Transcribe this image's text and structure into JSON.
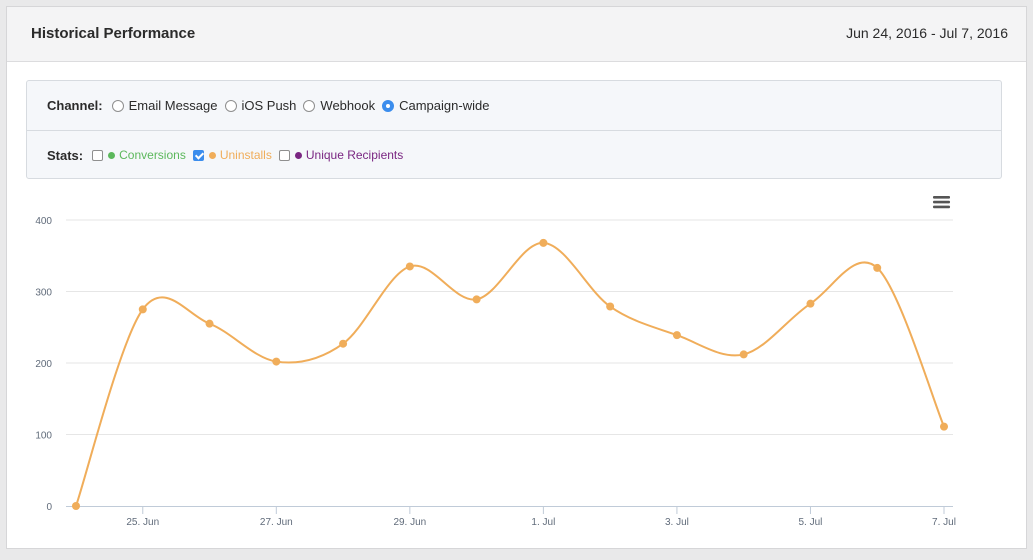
{
  "header": {
    "title": "Historical Performance",
    "date_range": "Jun 24, 2016 - Jul 7, 2016"
  },
  "channel": {
    "label": "Channel:",
    "options": [
      {
        "label": "Email Message",
        "selected": false
      },
      {
        "label": "iOS Push",
        "selected": false
      },
      {
        "label": "Webhook",
        "selected": false
      },
      {
        "label": "Campaign-wide",
        "selected": true
      }
    ]
  },
  "stats": {
    "label": "Stats:",
    "options": [
      {
        "label": "Conversions",
        "checked": false,
        "color": "#5cb85c"
      },
      {
        "label": "Uninstalls",
        "checked": true,
        "color": "#f0ad5a"
      },
      {
        "label": "Unique Recipients",
        "checked": false,
        "color": "#7a2682"
      }
    ]
  },
  "chart_menu_icon": "hamburger-menu-icon",
  "chart_data": {
    "type": "line",
    "title": "",
    "xlabel": "",
    "ylabel": "",
    "x": [
      "2016-06-24",
      "2016-06-25",
      "2016-06-26",
      "2016-06-27",
      "2016-06-28",
      "2016-06-29",
      "2016-06-30",
      "2016-07-01",
      "2016-07-02",
      "2016-07-03",
      "2016-07-04",
      "2016-07-05",
      "2016-07-06",
      "2016-07-07"
    ],
    "x_tick_labels": [
      "25. Jun",
      "27. Jun",
      "29. Jun",
      "1. Jul",
      "3. Jul",
      "5. Jul",
      "7. Jul"
    ],
    "y_ticks": [
      "0",
      "100",
      "200",
      "300",
      "400"
    ],
    "ylim": [
      0,
      400
    ],
    "grid": true,
    "legend": "none",
    "series": [
      {
        "values": [
          0,
          275,
          255,
          202,
          227,
          335,
          289,
          368,
          279,
          239,
          212,
          283,
          333,
          111
        ],
        "color": "#f0ad5a"
      }
    ]
  }
}
